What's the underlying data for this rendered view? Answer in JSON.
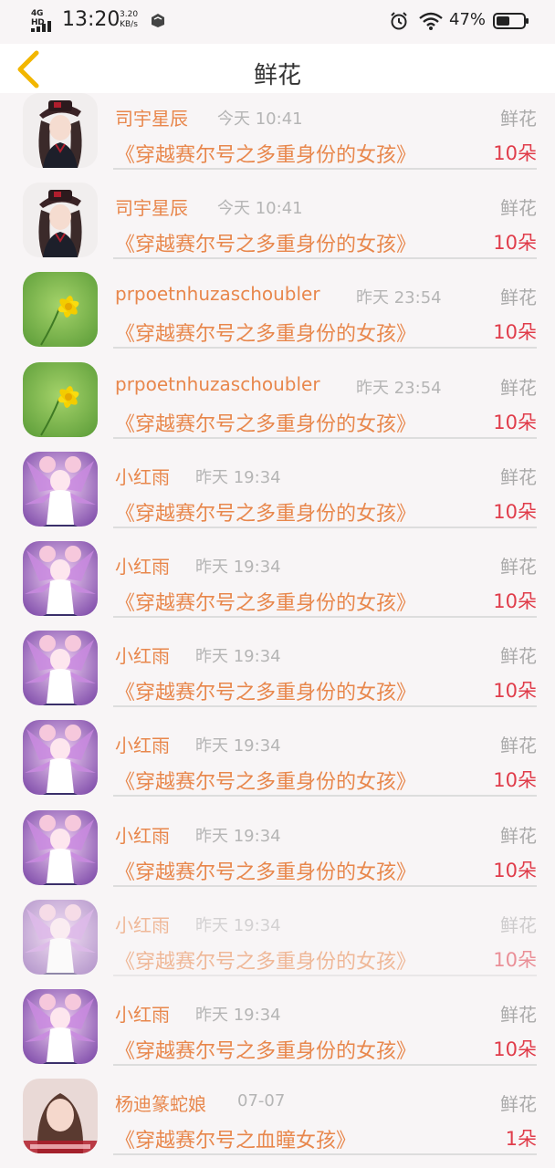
{
  "status_bar": {
    "network": "4G HD",
    "time": "13:20",
    "speed_value": "3.20",
    "speed_unit": "KB/s",
    "battery": "47%"
  },
  "header": {
    "title": "鲜花",
    "back_icon": "chevron-left-icon"
  },
  "colors": {
    "name": "#e8874c",
    "count": "#e03c4a",
    "muted": "#b5b5b5",
    "back": "#f2b600"
  },
  "rows": [
    {
      "name": "司宇星辰",
      "time": "今天 10:41",
      "type": "鲜花",
      "book": "《穿越赛尔号之多重身份的女孩》",
      "count": "10朵",
      "avatar": "anime-girl-hat"
    },
    {
      "name": "司宇星辰",
      "time": "今天 10:41",
      "type": "鲜花",
      "book": "《穿越赛尔号之多重身份的女孩》",
      "count": "10朵",
      "avatar": "anime-girl-hat"
    },
    {
      "name": "prpoetnhuzaschoubler",
      "time": "昨天 23:54",
      "type": "鲜花",
      "book": "《穿越赛尔号之多重身份的女孩》",
      "count": "10朵",
      "avatar": "yellow-flower"
    },
    {
      "name": "prpoetnhuzaschoubler",
      "time": "昨天 23:54",
      "type": "鲜花",
      "book": "《穿越赛尔号之多重身份的女孩》",
      "count": "10朵",
      "avatar": "yellow-flower"
    },
    {
      "name": "小红雨",
      "time": "昨天 19:34",
      "type": "鲜花",
      "book": "《穿越赛尔号之多重身份的女孩》",
      "count": "10朵",
      "avatar": "anime-girl-pink"
    },
    {
      "name": "小红雨",
      "time": "昨天 19:34",
      "type": "鲜花",
      "book": "《穿越赛尔号之多重身份的女孩》",
      "count": "10朵",
      "avatar": "anime-girl-pink"
    },
    {
      "name": "小红雨",
      "time": "昨天 19:34",
      "type": "鲜花",
      "book": "《穿越赛尔号之多重身份的女孩》",
      "count": "10朵",
      "avatar": "anime-girl-pink"
    },
    {
      "name": "小红雨",
      "time": "昨天 19:34",
      "type": "鲜花",
      "book": "《穿越赛尔号之多重身份的女孩》",
      "count": "10朵",
      "avatar": "anime-girl-pink"
    },
    {
      "name": "小红雨",
      "time": "昨天 19:34",
      "type": "鲜花",
      "book": "《穿越赛尔号之多重身份的女孩》",
      "count": "10朵",
      "avatar": "anime-girl-pink"
    },
    {
      "name": "小红雨",
      "time": "昨天 19:34",
      "type": "鲜花",
      "book": "《穿越赛尔号之多重身份的女孩》",
      "count": "10朵",
      "avatar": "anime-girl-pink",
      "faded": true
    },
    {
      "name": "小红雨",
      "time": "昨天 19:34",
      "type": "鲜花",
      "book": "《穿越赛尔号之多重身份的女孩》",
      "count": "10朵",
      "avatar": "anime-girl-pink"
    },
    {
      "name": "杨迪篆蛇娘",
      "time": "07-07",
      "type": "鲜花",
      "book": "《穿越赛尔号之血瞳女孩》",
      "count": "1朵",
      "avatar": "girl-photo"
    }
  ]
}
